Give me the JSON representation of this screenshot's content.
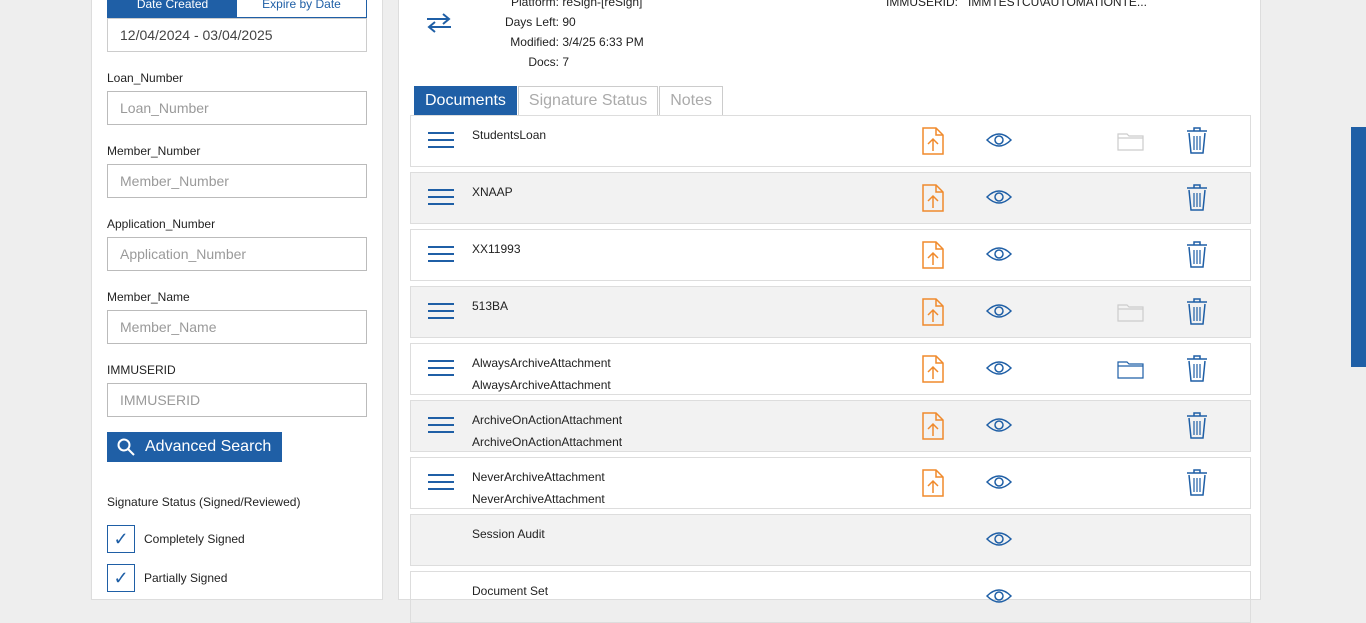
{
  "left": {
    "date_tabs": [
      "Date Created",
      "Expire by Date"
    ],
    "date_range": "12/04/2024 - 03/04/2025",
    "fields": [
      {
        "label": "Loan_Number",
        "placeholder": "Loan_Number"
      },
      {
        "label": "Member_Number",
        "placeholder": "Member_Number"
      },
      {
        "label": "Application_Number",
        "placeholder": "Application_Number"
      },
      {
        "label": "Member_Name",
        "placeholder": "Member_Name"
      },
      {
        "label": "IMMUSERID",
        "placeholder": "IMMUSERID"
      }
    ],
    "advanced_search_label": "Advanced Search",
    "signature_status_label": "Signature Status (Signed/Reviewed)",
    "checkboxes": [
      {
        "label": "Completely Signed",
        "checked": true
      },
      {
        "label": "Partially Signed",
        "checked": true
      }
    ]
  },
  "main": {
    "meta": [
      {
        "key": "Platform:",
        "value": "reSign-[reSign]"
      },
      {
        "key": "Days Left:",
        "value": "90"
      },
      {
        "key": "Modified:",
        "value": "3/4/25 6:33 PM"
      },
      {
        "key": "Docs:",
        "value": "7"
      }
    ],
    "meta_right": {
      "key": "IMMUSERID:",
      "value": "IMMTESTCU\\AUTOMATIONTE..."
    },
    "tabs": [
      "Documents",
      "Signature Status",
      "Notes"
    ],
    "documents": [
      {
        "names": [
          "StudentsLoan"
        ],
        "folder": "grey",
        "hamburger": true,
        "upload": true,
        "trash": true
      },
      {
        "names": [
          "XNAAP"
        ],
        "folder": "none",
        "hamburger": true,
        "upload": true,
        "trash": true
      },
      {
        "names": [
          "XX11993"
        ],
        "folder": "none",
        "hamburger": true,
        "upload": true,
        "trash": true
      },
      {
        "names": [
          "513BA"
        ],
        "folder": "grey",
        "hamburger": true,
        "upload": true,
        "trash": true
      },
      {
        "names": [
          "AlwaysArchiveAttachment",
          "AlwaysArchiveAttachment"
        ],
        "folder": "blue",
        "hamburger": true,
        "upload": true,
        "trash": true
      },
      {
        "names": [
          "ArchiveOnActionAttachment",
          "ArchiveOnActionAttachment"
        ],
        "folder": "none",
        "hamburger": true,
        "upload": true,
        "trash": true
      },
      {
        "names": [
          "NeverArchiveAttachment",
          "NeverArchiveAttachment"
        ],
        "folder": "none",
        "hamburger": true,
        "upload": true,
        "trash": true
      },
      {
        "names": [
          "Session Audit"
        ],
        "folder": "none",
        "hamburger": false,
        "upload": false,
        "trash": false
      },
      {
        "names": [
          "Document Set"
        ],
        "folder": "none",
        "hamburger": false,
        "upload": false,
        "trash": false
      }
    ]
  },
  "colors": {
    "accent": "#1f5fa6",
    "orange": "#f08a2c",
    "folder_grey": "#cccccc"
  }
}
